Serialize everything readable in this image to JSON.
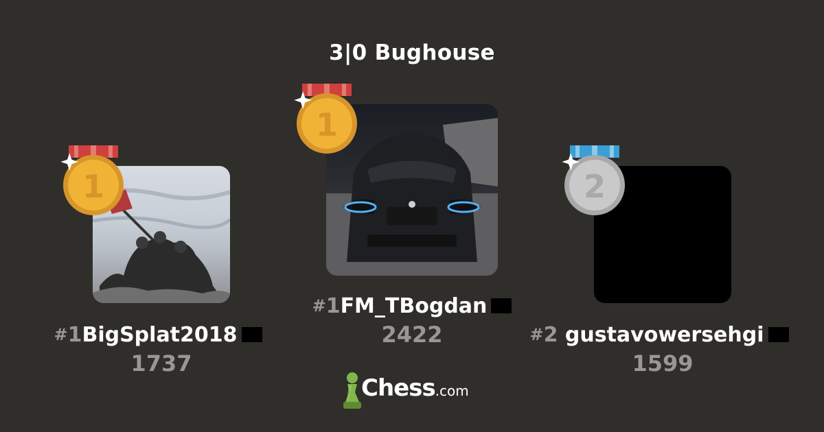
{
  "title": "3|0 Bughouse",
  "players": [
    {
      "rank_hash": "#",
      "rank": "1",
      "username": "BigSplat2018",
      "rating": "1737",
      "medal": "gold",
      "avatar": "iwo-jima-flag-raising-illustration"
    },
    {
      "rank_hash": "#",
      "rank": "1",
      "username": "FM_TBogdan",
      "rating": "2422",
      "medal": "gold",
      "avatar": "dark-car-front-at-night"
    },
    {
      "rank_hash": "#",
      "rank": "2",
      "username": "gustavowersehgi",
      "rating": "1599",
      "medal": "silver",
      "avatar": "black-square"
    }
  ],
  "medals": {
    "gold": {
      "digit": "1",
      "ribbon": "#d0403e",
      "face": "#f1b336",
      "rim": "#d8962a"
    },
    "silver": {
      "digit": "2",
      "ribbon": "#3a9fd4",
      "face": "#c9c9c9",
      "rim": "#a9a9a9"
    }
  },
  "logo": {
    "main": "Chess",
    "sub": ".com",
    "pawn_color": "#81b64c"
  },
  "colors": {
    "background": "#302e2b",
    "muted": "#989795"
  }
}
